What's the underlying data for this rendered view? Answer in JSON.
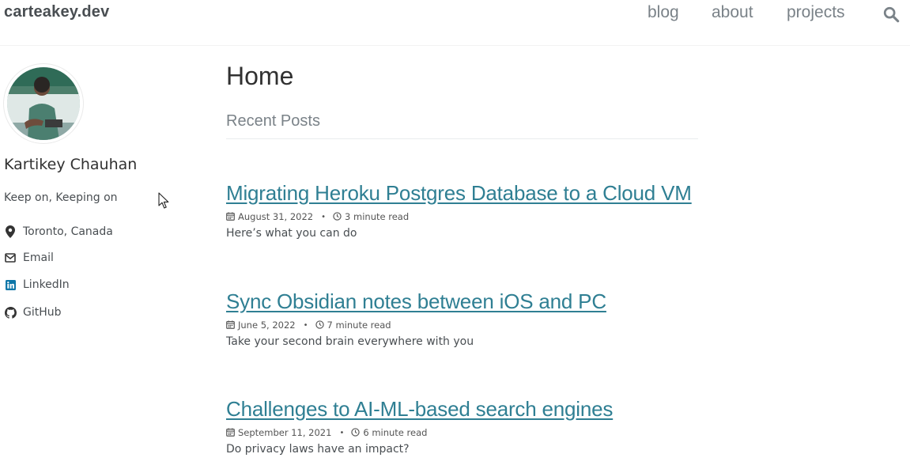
{
  "masthead": {
    "site_title": "carteakey.dev",
    "nav": [
      {
        "label": "blog"
      },
      {
        "label": "about"
      },
      {
        "label": "projects"
      }
    ],
    "search_icon": "search-icon"
  },
  "sidebar": {
    "author_name": "Kartikey Chauhan",
    "bio": "Keep on, Keeping on",
    "links": [
      {
        "label": "Toronto, Canada",
        "icon": "map-marker-icon"
      },
      {
        "label": "Email",
        "icon": "envelope-icon"
      },
      {
        "label": "LinkedIn",
        "icon": "linkedin-icon",
        "color": "#0e76a8"
      },
      {
        "label": "GitHub",
        "icon": "github-icon"
      }
    ]
  },
  "main": {
    "page_title": "Home",
    "section_title": "Recent Posts",
    "posts": [
      {
        "title": "Migrating Heroku Postgres Database to a Cloud VM",
        "date": "August 31, 2022",
        "read_time": "3 minute read",
        "excerpt": "Here’s what you can do"
      },
      {
        "title": "Sync Obsidian notes between iOS and PC",
        "date": "June 5, 2022",
        "read_time": "7 minute read",
        "excerpt": "Take your second brain everywhere with you"
      },
      {
        "title": "Challenges to AI-ML-based search engines",
        "date": "September 11, 2021",
        "read_time": "6 minute read",
        "excerpt": "Do privacy laws have an impact?"
      }
    ],
    "meta_separator": "•"
  },
  "colors": {
    "link": "#2f7f93",
    "text": "#494e52",
    "nav": "#7a8288"
  }
}
